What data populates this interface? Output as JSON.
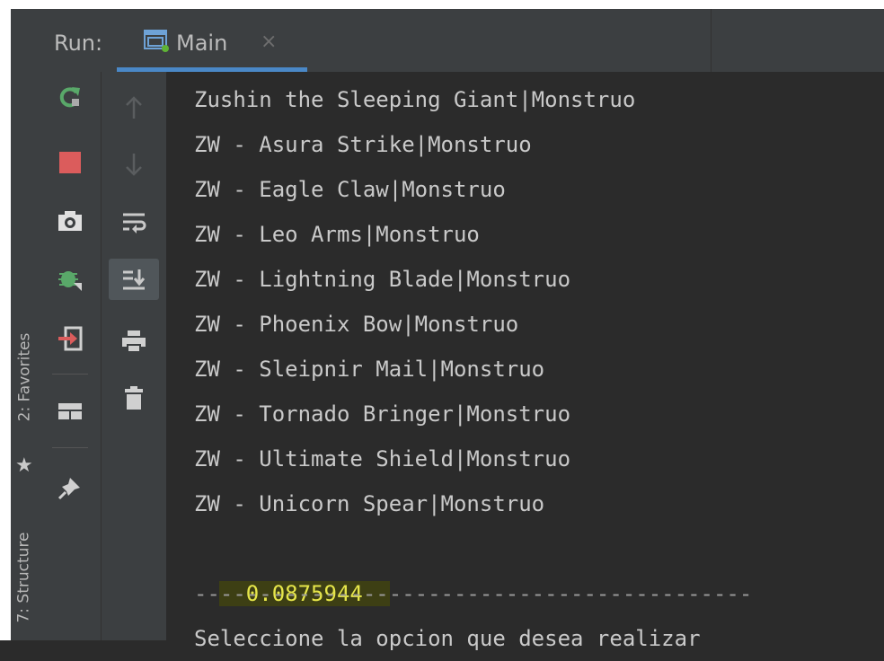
{
  "side_tabs": {
    "favorites": "2: Favorites",
    "structure": "7: Structure"
  },
  "header": {
    "run_label": "Run:",
    "tab_label": "Main",
    "tab_close": "×"
  },
  "toolbar_left": [
    {
      "name": "rerun-icon",
      "color": "#59a869"
    },
    {
      "name": "stop-icon",
      "color": "#db5c5c"
    },
    {
      "name": "camera-icon",
      "color": "#e0e0e0"
    },
    {
      "name": "debug-icon",
      "color": "#59a869"
    },
    {
      "name": "exit-icon",
      "color": "#db5c5c"
    },
    {
      "name": "layout-icon",
      "color": "#d0d0d0"
    },
    {
      "name": "pin-icon",
      "color": "#d0d0d0"
    }
  ],
  "toolbar_right": [
    {
      "name": "arrow-up-icon"
    },
    {
      "name": "arrow-down-icon"
    },
    {
      "name": "soft-wrap-icon"
    },
    {
      "name": "scroll-to-end-icon"
    },
    {
      "name": "print-icon"
    },
    {
      "name": "trash-icon"
    }
  ],
  "console": {
    "lines": [
      "Zushin the Sleeping Giant|Monstruo",
      "ZW - Asura Strike|Monstruo",
      "ZW - Eagle Claw|Monstruo",
      "ZW - Leo Arms|Monstruo",
      "ZW - Lightning Blade|Monstruo",
      "ZW - Phoenix Bow|Monstruo",
      "ZW - Sleipnir Mail|Monstruo",
      "ZW - Tornado Bringer|Monstruo",
      "ZW - Ultimate Shield|Monstruo",
      "ZW - Unicorn Spear|Monstruo"
    ],
    "highlight_value": "0.0875944",
    "separator": "-------------------------------------------",
    "prompt_partial": "Seleccione la opcion que desea realizar"
  },
  "colors": {
    "highlight_bg": "#3d3f14",
    "highlight_text": "#e6e64a",
    "tab_underline": "#4a88c7"
  }
}
